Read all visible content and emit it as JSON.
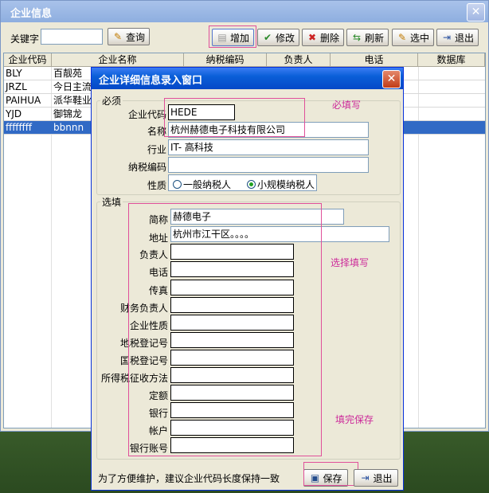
{
  "outer": {
    "title": "企业信息",
    "close_glyph": "✕",
    "keyword_label": "关键字",
    "keyword_value": "",
    "toolbar": {
      "search": "查询",
      "add": "增加",
      "edit": "修改",
      "delete": "删除",
      "refresh": "刷新",
      "select": "选中",
      "exit": "退出"
    }
  },
  "grid": {
    "columns": [
      "企业代码",
      "企业名称",
      "纳税编码",
      "负责人",
      "电话",
      "数据库"
    ],
    "rows": [
      {
        "code": "BLY",
        "name": "百靓苑"
      },
      {
        "code": "JRZL",
        "name": "今日主流"
      },
      {
        "code": "PAIHUA",
        "name": "派华鞋业"
      },
      {
        "code": "YJD",
        "name": "御锦龙"
      },
      {
        "code": "ffffffff",
        "name": "bbnnn"
      }
    ]
  },
  "dialog": {
    "title": "企业详细信息录入窗口",
    "close_glyph": "✕",
    "required_group": "必须",
    "optional_group": "选填",
    "required": {
      "code_label": "企业代码",
      "code_value": "HEDE",
      "name_label": "名称",
      "name_value": "杭州赫德电子科技有限公司",
      "industry_label": "行业",
      "industry_value": "IT- 高科技",
      "tax_code_label": "纳税编码",
      "tax_code_value": "",
      "nature_label": "性质",
      "nature_opt1": "一般纳税人",
      "nature_opt2": "小规模纳税人"
    },
    "optional": {
      "short_label": "简称",
      "short_value": "赫德电子",
      "address_label": "地址",
      "address_value": "杭州市江干区。。。。",
      "fields": [
        "负责人",
        "电话",
        "传真",
        "财务负责人",
        "企业性质",
        "地税登记号",
        "国税登记号",
        "所得税征收方法",
        "定额",
        "银行",
        "帐户",
        "银行账号"
      ]
    },
    "notes": {
      "must_fill": "必填写",
      "choose_fill": "选择填写",
      "fill_save": "填完保存"
    },
    "footer_hint": "为了方便维护，建议企业代码长度保持一致",
    "save": "保存",
    "exit": "退出"
  }
}
